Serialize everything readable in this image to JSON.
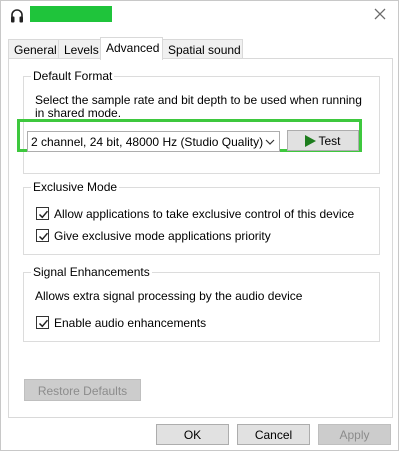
{
  "window": {
    "icon": "headphones-icon",
    "title_redacted_color": "#1fc43b"
  },
  "tabs": [
    {
      "label": "General",
      "active": false
    },
    {
      "label": "Levels",
      "active": false
    },
    {
      "label": "Advanced",
      "active": true
    },
    {
      "label": "Spatial sound",
      "active": false
    }
  ],
  "default_format": {
    "label": "Default Format",
    "description_line1": "Select the sample rate and bit depth to be used when running",
    "description_line2": "in shared mode.",
    "selected_format": "2 channel, 24 bit, 48000 Hz (Studio Quality)",
    "test_label": "Test",
    "highlight_color": "#3ec83e"
  },
  "exclusive_mode": {
    "label": "Exclusive Mode",
    "options": [
      {
        "label": "Allow applications to take exclusive control of this device",
        "checked": true
      },
      {
        "label": "Give exclusive mode applications priority",
        "checked": true
      }
    ]
  },
  "signal_enhancements": {
    "label": "Signal Enhancements",
    "description": "Allows extra signal processing by the audio device",
    "option": {
      "label": "Enable audio enhancements",
      "checked": true
    }
  },
  "buttons": {
    "restore_defaults": "Restore Defaults",
    "ok": "OK",
    "cancel": "Cancel",
    "apply": "Apply"
  }
}
